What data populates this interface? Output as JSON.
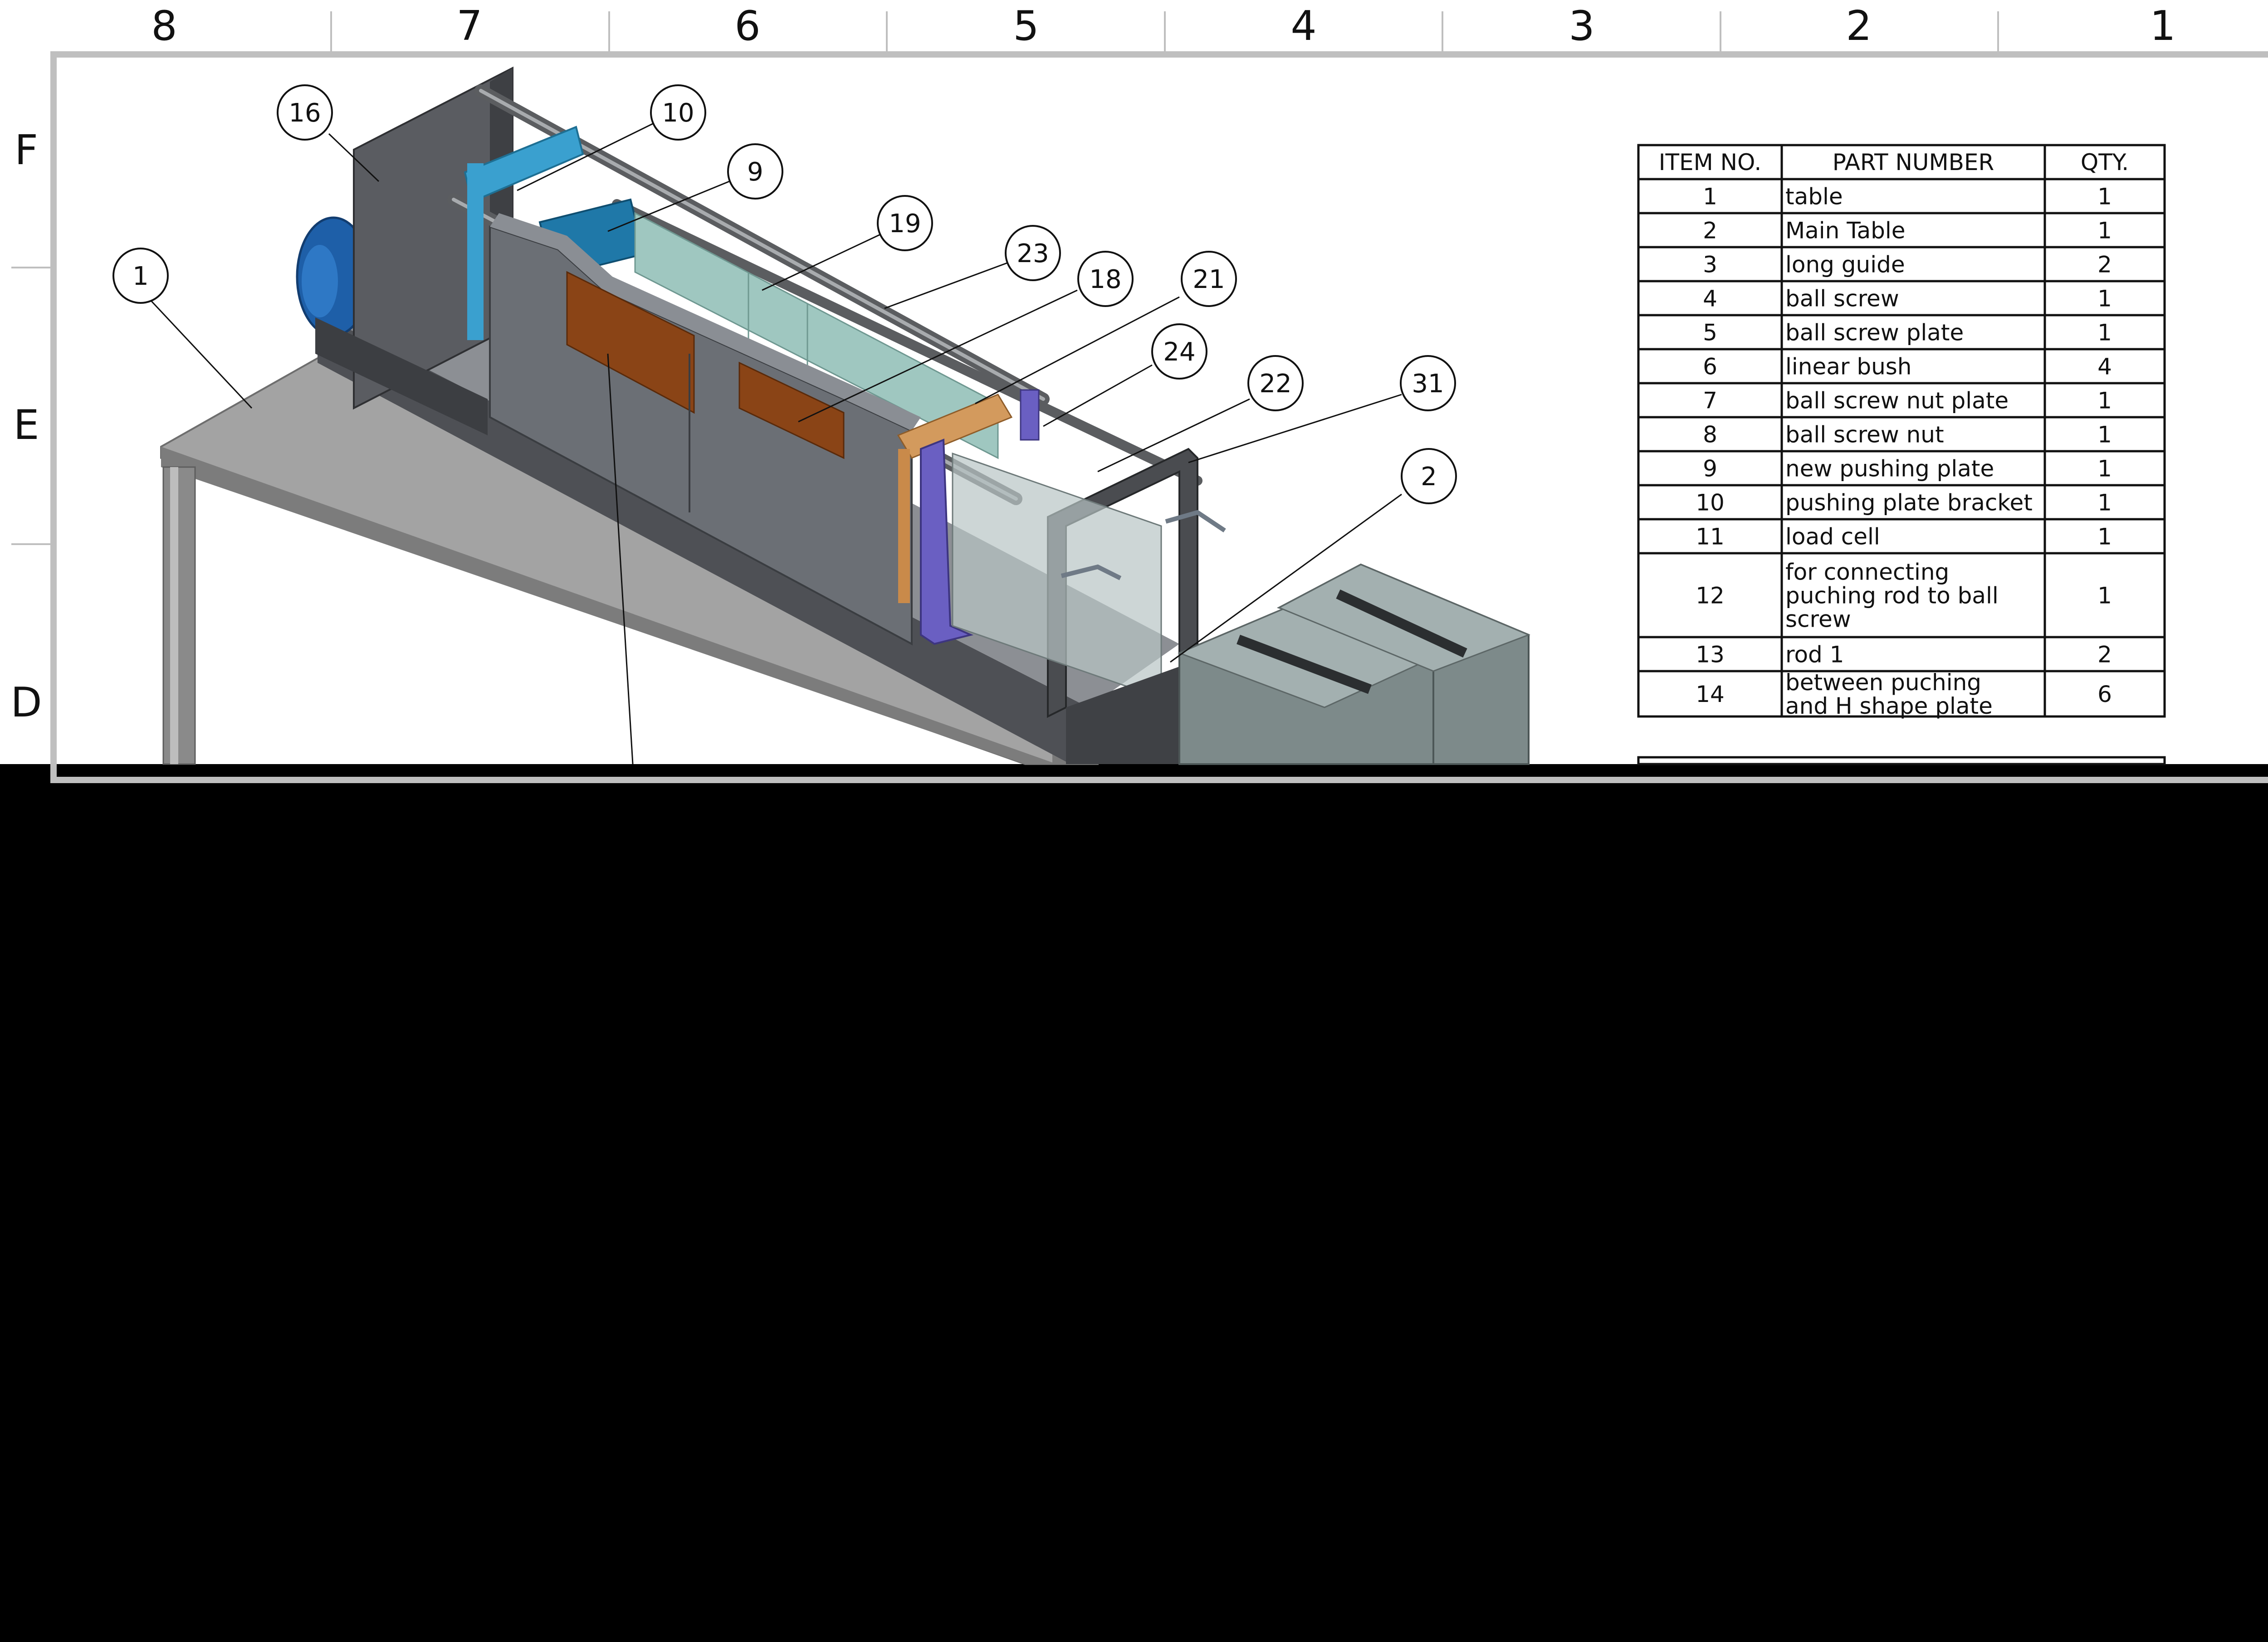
{
  "colors": {
    "sheet": "#ffffff",
    "blackout": "#000000",
    "frame": "#bfbfbf",
    "steel": "#6b6f75",
    "light_steel": "#9aa4a8",
    "motor_blue": "#1e5fa8",
    "bracket_blue": "#3aa0cf",
    "purple": "#6a5fc2",
    "orange": "#a0521d",
    "timber": "#d39a5d",
    "glass": "#9fc7c0"
  },
  "zones": {
    "columns": [
      "8",
      "7",
      "6",
      "5",
      "4",
      "3",
      "2",
      "1"
    ],
    "rows": [
      "F",
      "E",
      "D"
    ]
  },
  "balloons": [
    "16",
    "10",
    "9",
    "19",
    "23",
    "18",
    "21",
    "24",
    "22",
    "31",
    "2",
    "1"
  ],
  "bom": {
    "headers": {
      "item": "ITEM NO.",
      "part": "PART NUMBER",
      "qty": "QTY."
    },
    "rows": [
      {
        "item": "1",
        "part": [
          "table"
        ],
        "qty": "1"
      },
      {
        "item": "2",
        "part": [
          "Main Table"
        ],
        "qty": "1"
      },
      {
        "item": "3",
        "part": [
          "long guide"
        ],
        "qty": "2"
      },
      {
        "item": "4",
        "part": [
          "ball screw"
        ],
        "qty": "1"
      },
      {
        "item": "5",
        "part": [
          "ball screw plate"
        ],
        "qty": "1"
      },
      {
        "item": "6",
        "part": [
          "linear bush"
        ],
        "qty": "4"
      },
      {
        "item": "7",
        "part": [
          "ball screw nut plate"
        ],
        "qty": "1"
      },
      {
        "item": "8",
        "part": [
          "ball screw nut"
        ],
        "qty": "1"
      },
      {
        "item": "9",
        "part": [
          "new pushing plate"
        ],
        "qty": "1"
      },
      {
        "item": "10",
        "part": [
          "pushing plate bracket"
        ],
        "qty": "1"
      },
      {
        "item": "11",
        "part": [
          "load cell"
        ],
        "qty": "1"
      },
      {
        "item": "12",
        "part": [
          "for connecting",
          "puching rod to ball",
          "screw"
        ],
        "qty": "1"
      },
      {
        "item": "13",
        "part": [
          "rod 1"
        ],
        "qty": "2"
      },
      {
        "item": "14",
        "part": [
          "between puching",
          "and H shape plate"
        ],
        "qty": "6"
      }
    ]
  }
}
